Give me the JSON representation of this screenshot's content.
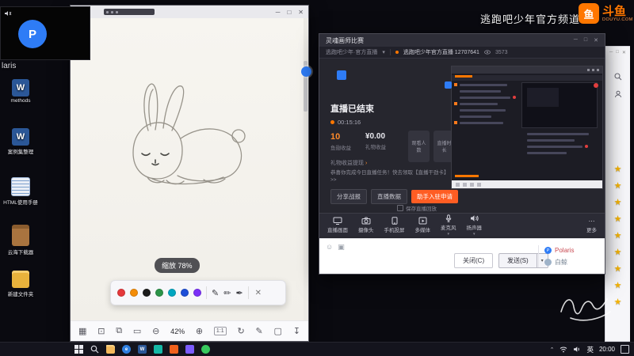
{
  "glyphs": {
    "min": "─",
    "max": "□",
    "close": "✕",
    "chev_down": "▾",
    "chev_up": "⌃",
    "dot": "●",
    "star": "★",
    "fwd": "›",
    "dots": "⋯",
    "smile": "☺",
    "img": "▣"
  },
  "watermark": {
    "channel": "逃跑吧少年官方频道",
    "logo": "斗鱼",
    "logo_mark": "鱼",
    "logo_sub": "DOUYU.COM"
  },
  "webcam": {
    "initial": "P",
    "name": "laris"
  },
  "desktop": {
    "icons": [
      {
        "label": "methods",
        "glyph": "W"
      },
      {
        "label": "案例集整理",
        "glyph": "W"
      },
      {
        "label": "HTML使用手册",
        "glyph": ""
      },
      {
        "label": "云海下载器",
        "glyph": ""
      },
      {
        "label": "新建文件夹",
        "glyph": ""
      }
    ]
  },
  "editor": {
    "toast": "缩放 78%",
    "zoom": "42%",
    "fit": "1:1",
    "icons": {
      "grid": "▦",
      "expand": "⊡",
      "copy": "⧉",
      "frame": "▭",
      "zoom_out": "⊖",
      "zoom_in": "⊕",
      "rotate": "↻",
      "edit": "✎",
      "crop": "▢",
      "download": "↧",
      "pen": "✎",
      "pen2": "✏",
      "pen3": "✒"
    },
    "pen_colors": [
      "#e5383b",
      "#f48c06",
      "#1b1b1b",
      "#2b9348",
      "#00a6c0",
      "#1d4ed8",
      "#7b2ff7"
    ]
  },
  "studio": {
    "window_title": "灵魂画师比赛",
    "tab_left": "逃跑吧少年·官方直播",
    "tab_right": "逃跑吧少年官方直播 12707641",
    "viewers": "3573",
    "ended_title": "直播已结束",
    "duration": "00:15:16",
    "stats": [
      {
        "value": "10",
        "label": "鱼翅收益"
      },
      {
        "value": "¥0.00",
        "label": "礼物收益"
      }
    ],
    "cards": [
      {
        "label": "观看人数"
      },
      {
        "label": "直播时长"
      }
    ],
    "withdraw_link": "礼物收益提现",
    "notice": "恭喜你完成今日直播任务！快去领取【直播干劲卡】>>",
    "buttons": [
      {
        "label": "分享战报"
      },
      {
        "label": "直播数据"
      }
    ],
    "cta": "助手入驻申请",
    "save_replay": "保存直播回放",
    "dock": [
      {
        "label": "直播画面"
      },
      {
        "label": "摄像头"
      },
      {
        "label": "手机投屏"
      },
      {
        "label": "多媒体"
      },
      {
        "label": "麦克风"
      },
      {
        "label": "扬声器"
      }
    ],
    "more": "更多",
    "close_button": "关闭(C)",
    "send_button": "发送(S)",
    "chat": [
      {
        "name": "Polaris"
      },
      {
        "name": "白鲸"
      }
    ]
  },
  "taskbar": {
    "ime": "英",
    "time": "20:00",
    "word": "W",
    "edge": "e"
  },
  "colors": {
    "douyu_orange": "#ff7700",
    "cta_red": "#ff5d23",
    "accent_blue": "#2e7cf6",
    "gold": "#f5b300"
  }
}
